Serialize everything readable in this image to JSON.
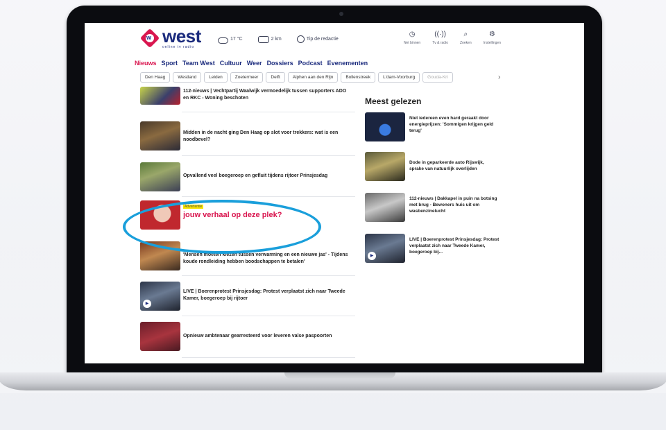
{
  "header": {
    "logo_word": "west",
    "logo_sub": "online tv radio",
    "weather": {
      "temp": "17 °C",
      "traffic": "2 km",
      "tip": "Tip de redactie"
    },
    "tools": [
      {
        "icon": "clock-icon",
        "label": "Net binnen"
      },
      {
        "icon": "broadcast-icon",
        "label": "Tv & radio"
      },
      {
        "icon": "search-icon",
        "label": "Zoeken"
      },
      {
        "icon": "gear-icon",
        "label": "Instellingen"
      }
    ]
  },
  "nav": [
    "Nieuws",
    "Sport",
    "Team West",
    "Cultuur",
    "Weer",
    "Dossiers",
    "Podcast",
    "Evenementen"
  ],
  "subnav": [
    "Den Haag",
    "Westland",
    "Leiden",
    "Zoetermeer",
    "Delft",
    "Alphen aan den Rijn",
    "Bollenstreek",
    "L'dam-Voorburg",
    "Gouda-Kri"
  ],
  "articles": [
    {
      "title": "112-nieuws | Vechtpartij Waalwijk vermoedelijk tussen supporters ADO en RKC - Woning beschoten"
    },
    {
      "title": "Midden in de nacht ging Den Haag op slot voor trekkers: wat is een noodbevel?"
    },
    {
      "title": "Opvallend veel boegeroep en gefluit tijdens rijtoer Prinsjesdag"
    },
    {
      "ad": "Advertentie",
      "title": "jouw verhaal op deze plek?"
    },
    {
      "title": "'Mensen moeten kiezen tussen verwarming en een nieuwe jas' - Tijdens koude rondleiding hebben boodschappen te betalen'"
    },
    {
      "title": "LIVE | Boerenprotest Prinsjesdag: Protest verplaatst zich naar Tweede Kamer, boegeroep bij rijtoer"
    },
    {
      "title": "Opnieuw ambtenaar gearresteerd voor leveren valse paspoorten"
    }
  ],
  "most_read": {
    "title": "Meest gelezen",
    "items": [
      {
        "title": "Niet iedereen even hard geraakt door energieprijzen: 'Sommigen krijgen geld terug'"
      },
      {
        "title": "Dode in geparkeerde auto Rijswijk, sprake van natuurlijk overlijden"
      },
      {
        "title": "112-nieuws | Dakkapel in puin na botsing met brug - Bewoners huis uit om wasbenzinelucht"
      },
      {
        "title": "LIVE | Boerenprotest Prinsjesdag: Protest verplaatst zich naar Tweede Kamer, boegeroep bij..."
      }
    ]
  }
}
